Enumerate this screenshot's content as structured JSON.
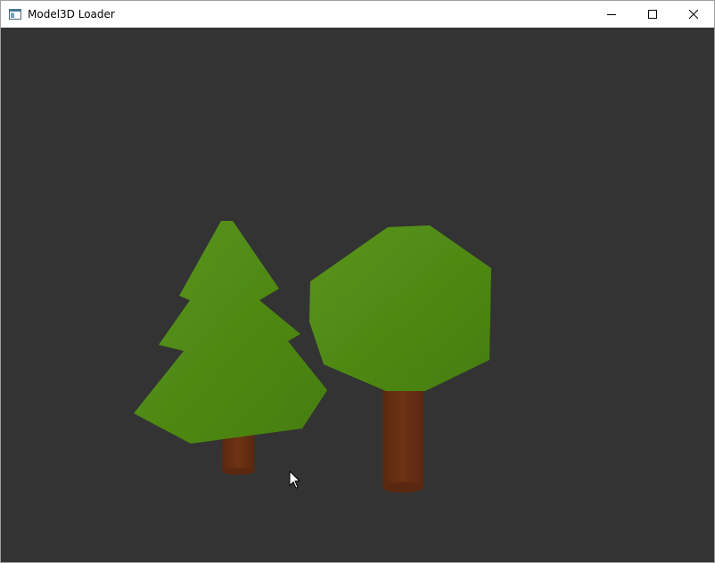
{
  "window": {
    "title": "Model3D Loader",
    "icons": {
      "app": "app-window-icon",
      "minimize": "minimize-icon",
      "maximize": "maximize-icon",
      "close": "close-icon"
    }
  },
  "scene": {
    "background_color": "#333333",
    "objects": [
      {
        "name": "pine-tree",
        "foliage_color": "#4a8a10",
        "trunk_color": "#6a3012"
      },
      {
        "name": "round-tree",
        "foliage_color": "#4a8a10",
        "trunk_color": "#6a3012"
      }
    ],
    "cursor": "mouse-pointer-icon"
  }
}
